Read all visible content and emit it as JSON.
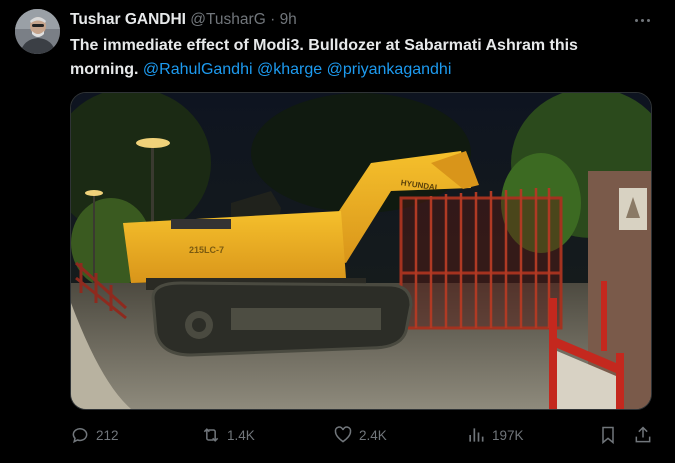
{
  "tweet": {
    "author_name": "Tushar GANDHI",
    "handle": "@TusharG",
    "separator": "·",
    "time": "9h",
    "text": "The immediate effect of Modi3. Bulldozer at Sabarmati Ashram this morning.",
    "mentions": [
      "@RahulGandhi",
      "@kharge",
      "@priyankagandhi"
    ]
  },
  "media": {
    "vehicle_brand": "HYUNDAI",
    "vehicle_model": "215LC-7",
    "vehicle_color": "#f2b21e",
    "gate_color": "#9a2a1e"
  },
  "actions": {
    "replies": "212",
    "reposts": "1.4K",
    "likes": "2.4K",
    "views": "197K"
  },
  "colors": {
    "background": "#000000",
    "text": "#e7e9ea",
    "secondary": "#71767b",
    "link": "#1d9bf0"
  }
}
